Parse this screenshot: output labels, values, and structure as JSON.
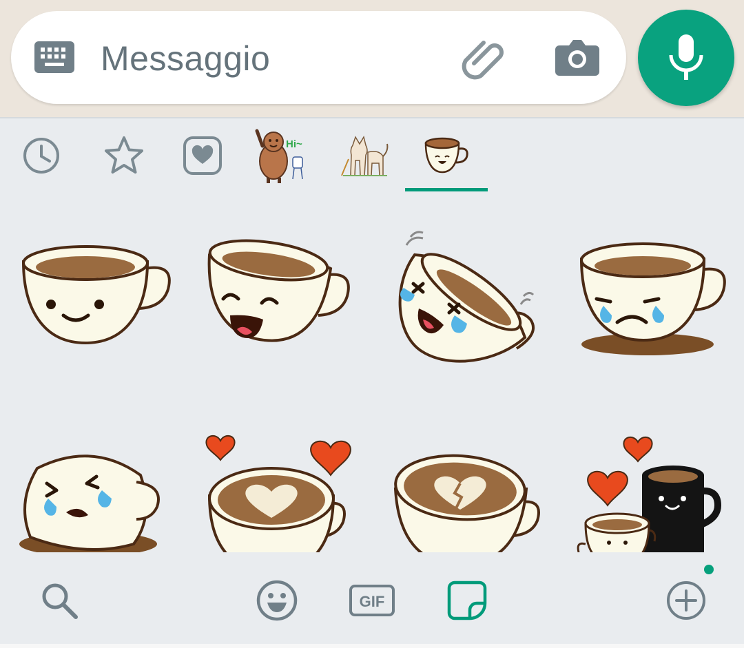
{
  "composer": {
    "placeholder": "Messaggio",
    "icons": [
      "keyboard-icon",
      "attach-icon",
      "camera-icon",
      "mic-icon"
    ],
    "accent": "#09a27f"
  },
  "sticker_tabs": [
    {
      "name": "recent-icon"
    },
    {
      "name": "favorites-icon"
    },
    {
      "name": "heart-icon"
    },
    {
      "name": "hi-character-pack",
      "label": "Hi~"
    },
    {
      "name": "dog-pack"
    },
    {
      "name": "coffee-pack",
      "selected": true
    }
  ],
  "stickers": [
    "coffee-cup-smile",
    "coffee-cup-laugh",
    "coffee-cup-tears-laugh",
    "coffee-cup-sad",
    "coffee-cup-cry-spill",
    "coffee-cup-heart-latte",
    "coffee-cup-broken-heart",
    "coffee-cups-love"
  ],
  "bottom_bar": {
    "gif_label": "GIF",
    "icons": [
      "search-icon",
      "emoji-icon",
      "gif-icon",
      "sticker-icon",
      "add-icon"
    ],
    "active": "sticker-icon"
  }
}
